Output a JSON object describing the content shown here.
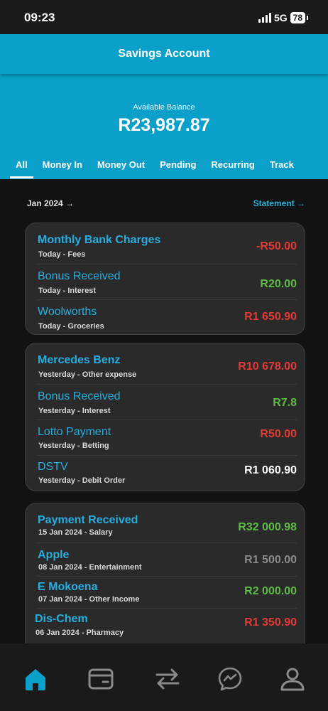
{
  "status": {
    "time": "09:23",
    "network": "5G",
    "battery": "78"
  },
  "header": {
    "title": "Savings Account"
  },
  "balance": {
    "label": "Available Balance",
    "value": "R23,987.87"
  },
  "tabs": [
    {
      "label": "All"
    },
    {
      "label": "Money In"
    },
    {
      "label": "Money Out"
    },
    {
      "label": "Pending"
    },
    {
      "label": "Recurring"
    },
    {
      "label": "Track"
    }
  ],
  "period": {
    "label": "Jan 2024 →",
    "statement": "Statement →"
  },
  "groups": [
    {
      "transactions": [
        {
          "name": "Monthly Bank Charges",
          "sub": "Today - Fees",
          "amount": "-R50.00"
        },
        {
          "name": "Bonus Received",
          "sub": "Today - Interest",
          "amount": "R20.00"
        },
        {
          "name": "Woolworths",
          "sub": "Today - Groceries",
          "amount": "R1 650.90"
        }
      ]
    },
    {
      "transactions": [
        {
          "name": "Mercedes Benz",
          "sub": "Yesterday - Other expense",
          "amount": "R10 678.00"
        },
        {
          "name": "Bonus Received",
          "sub": "Yesterday - Interest",
          "amount": "R7.8"
        },
        {
          "name": "Lotto Payment",
          "sub": "Yesterday - Betting",
          "amount": "R50.00"
        },
        {
          "name": "DSTV",
          "sub": "Yesterday - Debit Order",
          "amount": "R1 060.90"
        }
      ]
    },
    {
      "transactions": [
        {
          "name": "Payment Received",
          "sub": "15 Jan 2024 - Salary",
          "amount": "R32 000.98"
        },
        {
          "name": "Apple",
          "sub": "08 Jan 2024 - Entertainment",
          "amount": "R1 500.00"
        },
        {
          "name": "E Mokoena",
          "sub": "07 Jan 2024 - Other Income",
          "amount": "R2 000.00"
        },
        {
          "name": "Dis-Chem",
          "sub": "06 Jan 2024 - Pharmacy",
          "amount": "R1 350.90"
        }
      ]
    }
  ],
  "nav": [
    {
      "icon": "home-icon"
    },
    {
      "icon": "card-icon"
    },
    {
      "icon": "transfer-icon"
    },
    {
      "icon": "chat-icon"
    },
    {
      "icon": "profile-icon"
    }
  ],
  "colors": {
    "brand": "#0aa0c9",
    "link": "#27aee0",
    "debit": "#e53935",
    "credit": "#5dbb46"
  }
}
